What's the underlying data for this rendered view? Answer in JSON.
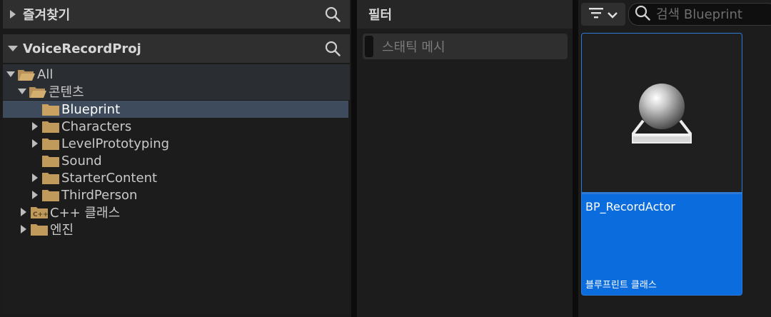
{
  "favorites": {
    "title": "즐겨찾기",
    "search_icon": "search-icon"
  },
  "project": {
    "title": "VoiceRecordProj",
    "search_icon": "search-icon"
  },
  "tree": {
    "items": [
      {
        "label": "All",
        "expanded": true,
        "indent": 0
      },
      {
        "label": "콘텐츠",
        "expanded": true,
        "indent": 1
      },
      {
        "label": "Blueprint",
        "selected": true,
        "indent": 2
      },
      {
        "label": "Characters",
        "indent": 2
      },
      {
        "label": "LevelPrototyping",
        "indent": 2
      },
      {
        "label": "Sound",
        "indent": 2
      },
      {
        "label": "StarterContent",
        "indent": 2
      },
      {
        "label": "ThirdPerson",
        "indent": 2
      },
      {
        "label": "C++ 클래스",
        "indent": 1
      },
      {
        "label": "엔진",
        "indent": 1
      }
    ],
    "cpp_badge": "C++"
  },
  "filter": {
    "title": "필터",
    "chip_label": "스태틱 메시"
  },
  "content": {
    "search_placeholder": "검색 Blueprint",
    "asset": {
      "name": "BP_RecordActor",
      "type": "블루프린트 클래스"
    }
  },
  "colors": {
    "selection": "#3d4b5c",
    "accent": "#0b6cde",
    "folder": "#c09a5a"
  }
}
